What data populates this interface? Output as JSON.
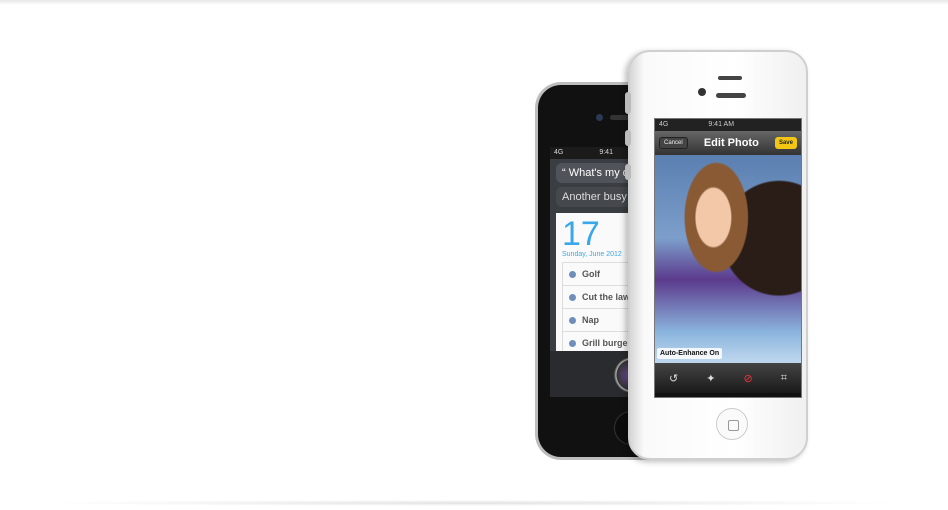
{
  "black_phone": {
    "status": {
      "signal": "4G",
      "time": "9:41"
    },
    "siri_query": "“ What's my d",
    "siri_response": "Another busy d",
    "calendar": {
      "day": "17",
      "date": "Sunday, June 2012",
      "events": [
        "Golf",
        "Cut the lawn",
        "Nap",
        "Grill burgers"
      ]
    }
  },
  "white_phone": {
    "status": {
      "signal": "4G",
      "time": "9:41 AM"
    },
    "nav": {
      "cancel": "Cancel",
      "title": "Edit Photo",
      "save": "Save"
    },
    "photo_label": "Auto-Enhance On",
    "toolbar": {
      "rotate": "↺",
      "enhance": "✦",
      "redeye": "⊘",
      "crop": "⌗"
    }
  }
}
